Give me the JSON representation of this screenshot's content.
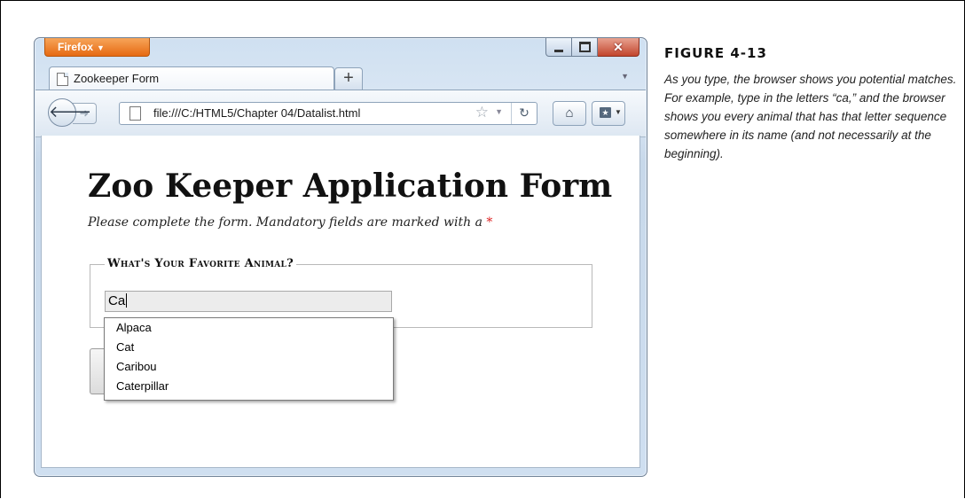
{
  "browser": {
    "menu_button": "Firefox",
    "tab_title": "Zookeeper Form",
    "new_tab": "+",
    "url": "file:///C:/HTML5/Chapter 04/Datalist.html"
  },
  "page": {
    "title": "Zoo Keeper Application Form",
    "subtitle": "Please complete the form. Mandatory fields are marked with a",
    "required_marker": "*",
    "fieldset_legend": "What's Your Favorite Animal?",
    "input_value": "Ca",
    "suggestions": [
      "Alpaca",
      "Cat",
      "Caribou",
      "Caterpillar"
    ]
  },
  "caption": {
    "label": "FIGURE 4-13",
    "text": "As you type, the browser shows you potential matches. For example, type in the letters “ca,” and the browser shows you every animal that has that letter sequence somewhere in its name (and not necessarily at the beginning)."
  },
  "icons": [
    "back-arrow-icon",
    "forward-arrow-icon",
    "page-icon",
    "star-icon",
    "reload-icon",
    "home-icon",
    "bookmarks-icon",
    "minimize-icon",
    "maximize-icon",
    "close-icon"
  ],
  "colors": {
    "firefox_button": "#e66a12",
    "required_marker": "#dd2222",
    "close_button": "#c2452d"
  }
}
